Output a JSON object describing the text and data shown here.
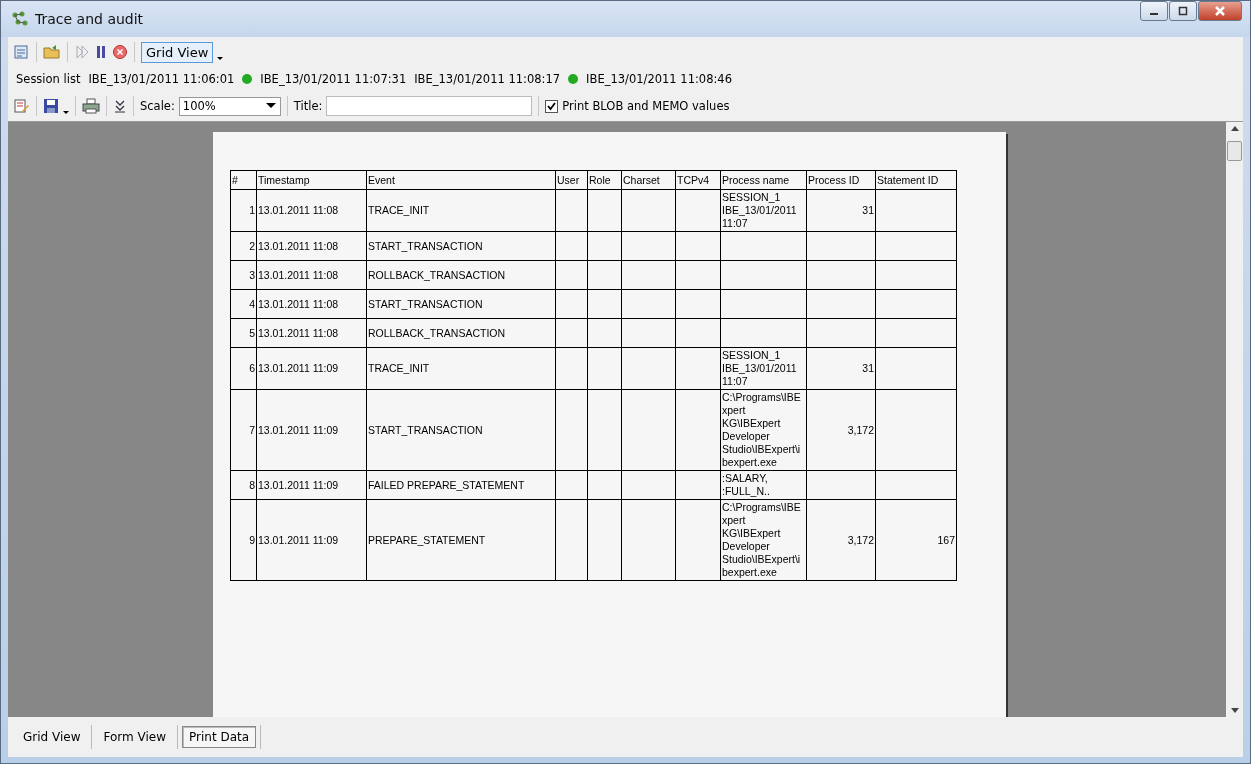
{
  "window": {
    "title": "Trace and audit"
  },
  "toolbar": {
    "view_button": "Grid View"
  },
  "session_list": {
    "label": "Session list",
    "sessions": [
      {
        "name": "IBE_13/01/2011 11:06:01",
        "active": false
      },
      {
        "name": "IBE_13/01/2011 11:07:31",
        "active": true
      },
      {
        "name": "IBE_13/01/2011 11:08:17",
        "active": false
      },
      {
        "name": "IBE_13/01/2011 11:08:46",
        "active": true
      }
    ]
  },
  "print_toolbar": {
    "scale_label": "Scale:",
    "scale_value": "100%",
    "title_label": "Title:",
    "print_blob": {
      "label": "Print BLOB and MEMO values",
      "checked": true
    }
  },
  "table": {
    "columns": [
      "#",
      "Timestamp",
      "Event",
      "User",
      "Role",
      "Charset",
      "TCPv4",
      "Process name",
      "Process ID",
      "Statement ID"
    ],
    "rows": [
      {
        "n": "1",
        "timestamp": "13.01.2011 11:08",
        "event": "TRACE_INIT",
        "process_name": "SESSION_1\nIBE_13/01/2011\n11:07",
        "process_id": "31",
        "statement_id": ""
      },
      {
        "n": "2",
        "timestamp": "13.01.2011 11:08",
        "event": "START_TRANSACTION",
        "process_name": "",
        "process_id": "",
        "statement_id": ""
      },
      {
        "n": "3",
        "timestamp": "13.01.2011 11:08",
        "event": "ROLLBACK_TRANSACTION",
        "process_name": "",
        "process_id": "",
        "statement_id": ""
      },
      {
        "n": "4",
        "timestamp": "13.01.2011 11:08",
        "event": "START_TRANSACTION",
        "process_name": "",
        "process_id": "",
        "statement_id": ""
      },
      {
        "n": "5",
        "timestamp": "13.01.2011 11:08",
        "event": "ROLLBACK_TRANSACTION",
        "process_name": "",
        "process_id": "",
        "statement_id": ""
      },
      {
        "n": "6",
        "timestamp": "13.01.2011 11:09",
        "event": "TRACE_INIT",
        "process_name": "SESSION_1\nIBE_13/01/2011\n11:07",
        "process_id": "31",
        "statement_id": ""
      },
      {
        "n": "7",
        "timestamp": "13.01.2011 11:09",
        "event": "START_TRANSACTION",
        "process_name": "C:\\Programs\\IBE\nxpert\nKG\\IBExpert\nDeveloper\nStudio\\IBExpert\\i\nbexpert.exe",
        "process_id": "3,172",
        "statement_id": ""
      },
      {
        "n": "8",
        "timestamp": "13.01.2011 11:09",
        "event": "FAILED PREPARE_STATEMENT",
        "process_name": ":SALARY,\n:FULL_N..",
        "process_id": "",
        "statement_id": ""
      },
      {
        "n": "9",
        "timestamp": "13.01.2011 11:09",
        "event": "PREPARE_STATEMENT",
        "process_name": "C:\\Programs\\IBE\nxpert\nKG\\IBExpert\nDeveloper\nStudio\\IBExpert\\i\nbexpert.exe",
        "process_id": "3,172",
        "statement_id": "167"
      }
    ]
  },
  "bottom_tabs": [
    {
      "label": "Grid View",
      "selected": false
    },
    {
      "label": "Form View",
      "selected": false
    },
    {
      "label": "Print Data",
      "selected": true
    }
  ]
}
